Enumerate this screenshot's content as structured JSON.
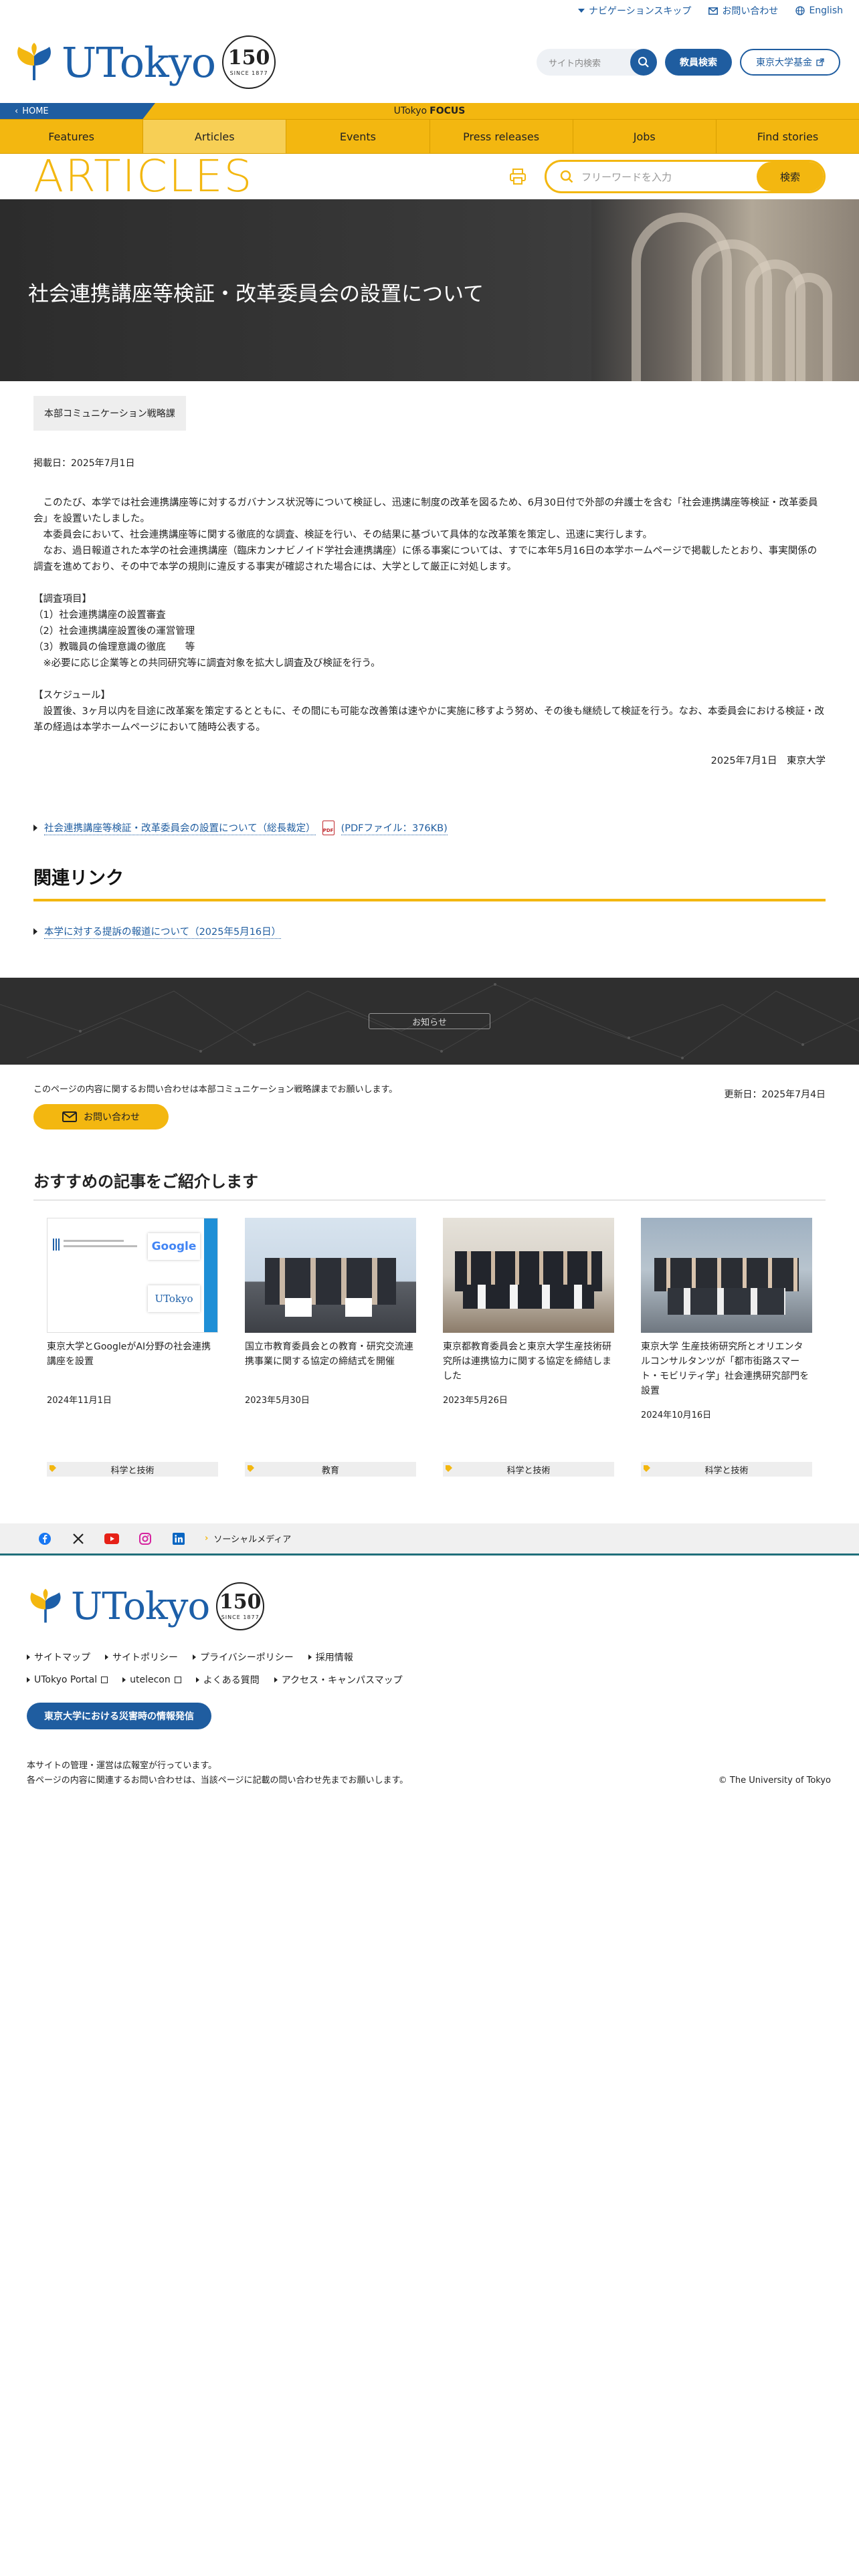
{
  "utility": {
    "skip_nav": "ナビゲーションスキップ",
    "contact": "お問い合わせ",
    "english": "English"
  },
  "header": {
    "logo_text": "UTokyo",
    "anniversary": "150",
    "anniversary_since": "SINCE 1877",
    "search_placeholder": "サイト内検索",
    "faculty_search": "教員検索",
    "fund": "東京大学基金"
  },
  "focus_bar": {
    "home": "HOME",
    "brand_prefix": "UTokyo",
    "brand_suffix": "FOCUS"
  },
  "nav": {
    "items": [
      "Features",
      "Articles",
      "Events",
      "Press releases",
      "Jobs",
      "Find stories"
    ],
    "active": "Articles"
  },
  "articles_head": {
    "title": "ARTICLES",
    "keyword_placeholder": "フリーワードを入力",
    "search_button": "検索"
  },
  "hero": {
    "title": "社会連携講座等検証・改革委員会の設置について"
  },
  "article": {
    "department": "本部コミュニケーション戦略課",
    "posted": "掲載日：2025年7月1日",
    "paragraphs": [
      "　このたび、本学では社会連携講座等に対するガバナンス状況等について検証し、迅速に制度の改革を図るため、6月30日付で外部の弁護士を含む「社会連携講座等検証・改革委員会」を設置いたしました。",
      "　本委員会において、社会連携講座等に関する徹底的な調査、検証を行い、その結果に基づいて具体的な改革策を策定し、迅速に実行します。",
      "　なお、過日報道された本学の社会連携講座（臨床カンナビノイド学社会連携講座）に係る事案については、すでに本年5月16日の本学ホームページで掲載したとおり、事実関係の調査を進めており、その中で本学の規則に違反する事実が確認された場合には、大学として厳正に対処します。",
      "",
      "【調査項目】",
      "（1）社会連携講座の設置審査",
      "（2）社会連携講座設置後の運営管理",
      "（3）教職員の倫理意識の徹底　　等",
      "　※必要に応じ企業等との共同研究等に調査対象を拡大し調査及び検証を行う。",
      "",
      "【スケジュール】",
      "　設置後、3ヶ月以内を目途に改革案を策定するとともに、その間にも可能な改善策は速やかに実施に移すよう努め、その後も継続して検証を行う。なお、本委員会における検証・改革の経過は本学ホームページにおいて随時公表する。"
    ],
    "signature": "2025年7月1日　東京大学",
    "pdf_link": "社会連携講座等検証・改革委員会の設置について（総長裁定）",
    "pdf_icon": "PDF",
    "pdf_size": "(PDFファイル：376KB)"
  },
  "related": {
    "heading": "関連リンク",
    "link": "本学に対する提訴の報道について（2025年5月16日）"
  },
  "notice": {
    "button": "お知らせ"
  },
  "contact_row": {
    "note": "このページの内容に関するお問い合わせは本部コミュニケーション戦略課までお願いします。",
    "button": "お問い合わせ",
    "updated": "更新日：2025年7月4日"
  },
  "recommend": {
    "heading": "おすすめの記事をご紹介します",
    "cards": [
      {
        "title": "東京大学とGoogleがAI分野の社会連携講座を設置",
        "date": "2024年11月1日",
        "tag": "科学と技術"
      },
      {
        "title": "国立市教育委員会との教育・研究交流連携事業に関する協定の締結式を開催",
        "date": "2023年5月30日",
        "tag": "教育"
      },
      {
        "title": "東京都教育委員会と東京大学生産技術研究所は連携協力に関する協定を締結しました",
        "date": "2023年5月26日",
        "tag": "科学と技術"
      },
      {
        "title": "東京大学 生産技術研究所とオリエンタルコンサルタンツが「都市街路スマート・モビリティ学」社会連携研究部門を設置",
        "date": "2024年10月16日",
        "tag": "科学と技術"
      }
    ],
    "card1_img_text": "Google"
  },
  "social": {
    "label": "ソーシャルメディア"
  },
  "footer": {
    "links": [
      "サイトマップ",
      "サイトポリシー",
      "プライバシーポリシー",
      "採用情報",
      "UTokyo Portal",
      "utelecon",
      "よくある質問",
      "アクセス・キャンパスマップ"
    ],
    "disaster": "東京大学における災害時の情報発信",
    "managed": "本サイトの管理・運営は広報室が行っています。",
    "inquiry": "各ページの内容に関連するお問い合わせは、当該ページに記載の問い合わせ先までお願いします。",
    "copyright": "© The University of Tokyo"
  },
  "colors": {
    "brand_blue": "#1f5da0",
    "accent_yellow": "#f3b710"
  }
}
